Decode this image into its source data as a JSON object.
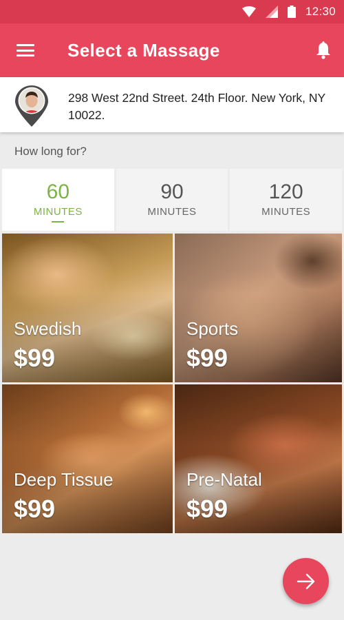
{
  "status_bar": {
    "time": "12:30",
    "icons": [
      "wifi-icon",
      "signal-icon",
      "battery-icon"
    ]
  },
  "app_bar": {
    "title": "Select a Massage",
    "menu_icon": "menu-icon",
    "notification_icon": "bell-icon"
  },
  "address": {
    "text": "298 West 22nd Street. 24th Floor. New York, NY 10022.",
    "icon": "location-pin-avatar"
  },
  "duration": {
    "label": "How long for?",
    "options": [
      {
        "value": "60",
        "unit": "MINUTES",
        "selected": true
      },
      {
        "value": "90",
        "unit": "MINUTES",
        "selected": false
      },
      {
        "value": "120",
        "unit": "MINUTES",
        "selected": false
      }
    ]
  },
  "massages": [
    {
      "name": "Swedish",
      "price": "$99"
    },
    {
      "name": "Sports",
      "price": "$99"
    },
    {
      "name": "Deep Tissue",
      "price": "$99"
    },
    {
      "name": "Pre-Natal",
      "price": "$99"
    }
  ],
  "fab": {
    "icon": "arrow-right-icon"
  },
  "colors": {
    "primary": "#e8465c",
    "status_bar": "#d93a4f",
    "accent": "#7cb342",
    "background": "#ececec"
  }
}
